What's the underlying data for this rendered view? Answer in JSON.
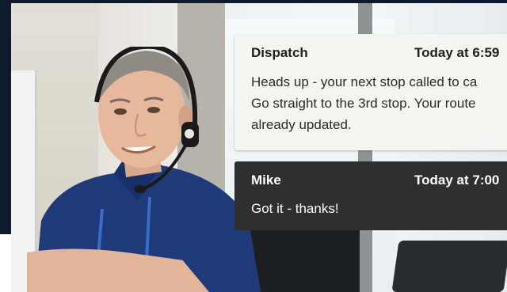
{
  "messages": [
    {
      "sender": "Dispatch",
      "time": "Today at 6:59",
      "text_lines": [
        "Heads up - your next stop called to ca",
        "Go straight to the 3rd stop. Your route",
        "already updated."
      ]
    },
    {
      "sender": "Mike",
      "time": "Today at 7:00",
      "text_lines": [
        "Got it - thanks!"
      ]
    }
  ],
  "colors": {
    "dispatch_card_bg": "#f4f4f2",
    "reply_card_bg": "#2f2f30",
    "navy_edge": "#0c1a2c",
    "shirt": "#1f3a78"
  }
}
